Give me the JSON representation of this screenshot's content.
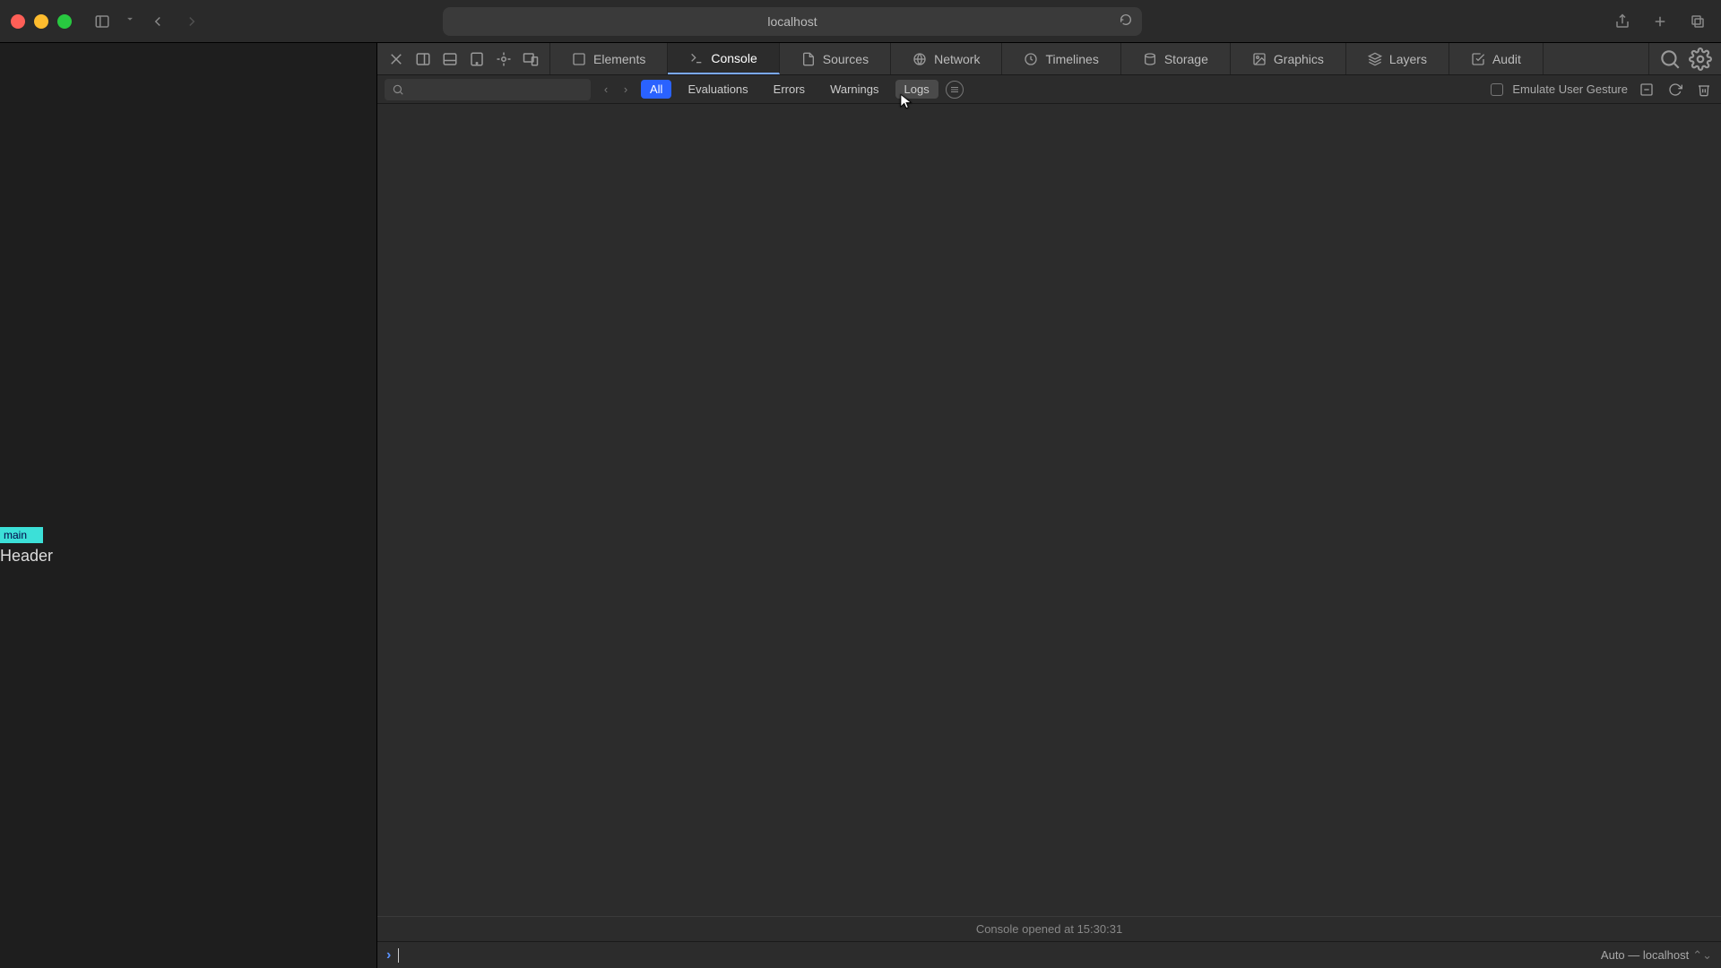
{
  "browser": {
    "address": "localhost"
  },
  "page": {
    "badge": "main",
    "header": "Header"
  },
  "devtools": {
    "tabs": {
      "elements": "Elements",
      "console": "Console",
      "sources": "Sources",
      "network": "Network",
      "timelines": "Timelines",
      "storage": "Storage",
      "graphics": "Graphics",
      "layers": "Layers",
      "audit": "Audit"
    },
    "filters": {
      "all": "All",
      "evaluations": "Evaluations",
      "errors": "Errors",
      "warnings": "Warnings",
      "logs": "Logs"
    },
    "emulate_label": "Emulate User Gesture",
    "status": "Console opened at 15:30:31",
    "context": "Auto — localhost"
  }
}
